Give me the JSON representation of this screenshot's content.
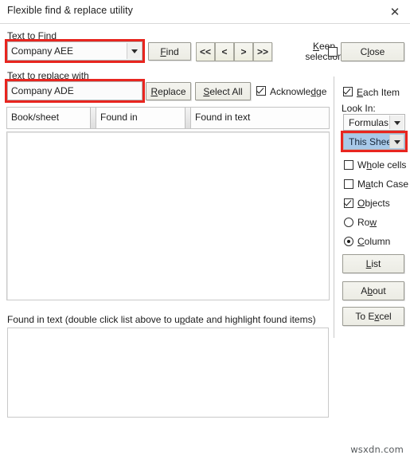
{
  "window": {
    "title": "Flexible find & replace utility",
    "close_icon": "close-icon",
    "close_glyph": "✕"
  },
  "find": {
    "label": "Text to Find",
    "label_accel": "T",
    "value": "Company AEE",
    "placeholder": "",
    "dropdown_icon": "chevron-down-icon",
    "find_button": "Find",
    "find_button_accel": "F"
  },
  "nav": {
    "first": "<<",
    "prev": "<",
    "next": ">",
    "last": ">>"
  },
  "keep_selection": {
    "label_line1": "Keep",
    "label_line2": "selection",
    "accel": "K",
    "checked": false
  },
  "close_button": {
    "label": "Close",
    "accel": "l"
  },
  "replace": {
    "label": "Text to replace with",
    "label_accel": "p",
    "value": "Company ADE",
    "replace_button": "Replace",
    "replace_button_accel": "R",
    "select_all_button": "Select All",
    "select_all_accel": "S",
    "acknowledge_label": "Acknowledge",
    "acknowledge_accel": "dg",
    "acknowledge_checked": true
  },
  "list": {
    "columns": [
      {
        "label": "Book/sheet"
      },
      {
        "label": "Found in"
      },
      {
        "label": "Found in text"
      }
    ],
    "rows": []
  },
  "found_in_text": {
    "label": "Found in text (double click list above to update and highlight found items)",
    "label_accel": "p",
    "value": ""
  },
  "options": {
    "each_item": {
      "label": "Each Item",
      "accel": "E",
      "checked": true
    },
    "look_in_label": "Look In:",
    "look_in_value": "Formulas",
    "scope_value": "This Shee",
    "scope_selected": true,
    "whole_cells": {
      "label": "Whole cells",
      "accel": "h",
      "checked": false
    },
    "match_case": {
      "label": "Match Case",
      "accel": "a",
      "checked": false
    },
    "objects": {
      "label": "Objects",
      "accel": "O",
      "checked": true
    },
    "row": {
      "label": "Row",
      "accel": "w",
      "selected": false
    },
    "column": {
      "label": "Column",
      "accel": "C",
      "selected": true
    }
  },
  "side_buttons": {
    "list": {
      "label": "List",
      "accel": "L"
    },
    "about": {
      "label": "About",
      "accel": "b"
    },
    "to_excel": {
      "label": "To Excel",
      "accel": "x"
    }
  },
  "watermark": "wsxdn.com",
  "colors": {
    "highlight_red": "#e8251f",
    "selection_blue": "#a8c9e8",
    "button_face": "#eeeee6",
    "dialog_bg": "#ffffff"
  }
}
